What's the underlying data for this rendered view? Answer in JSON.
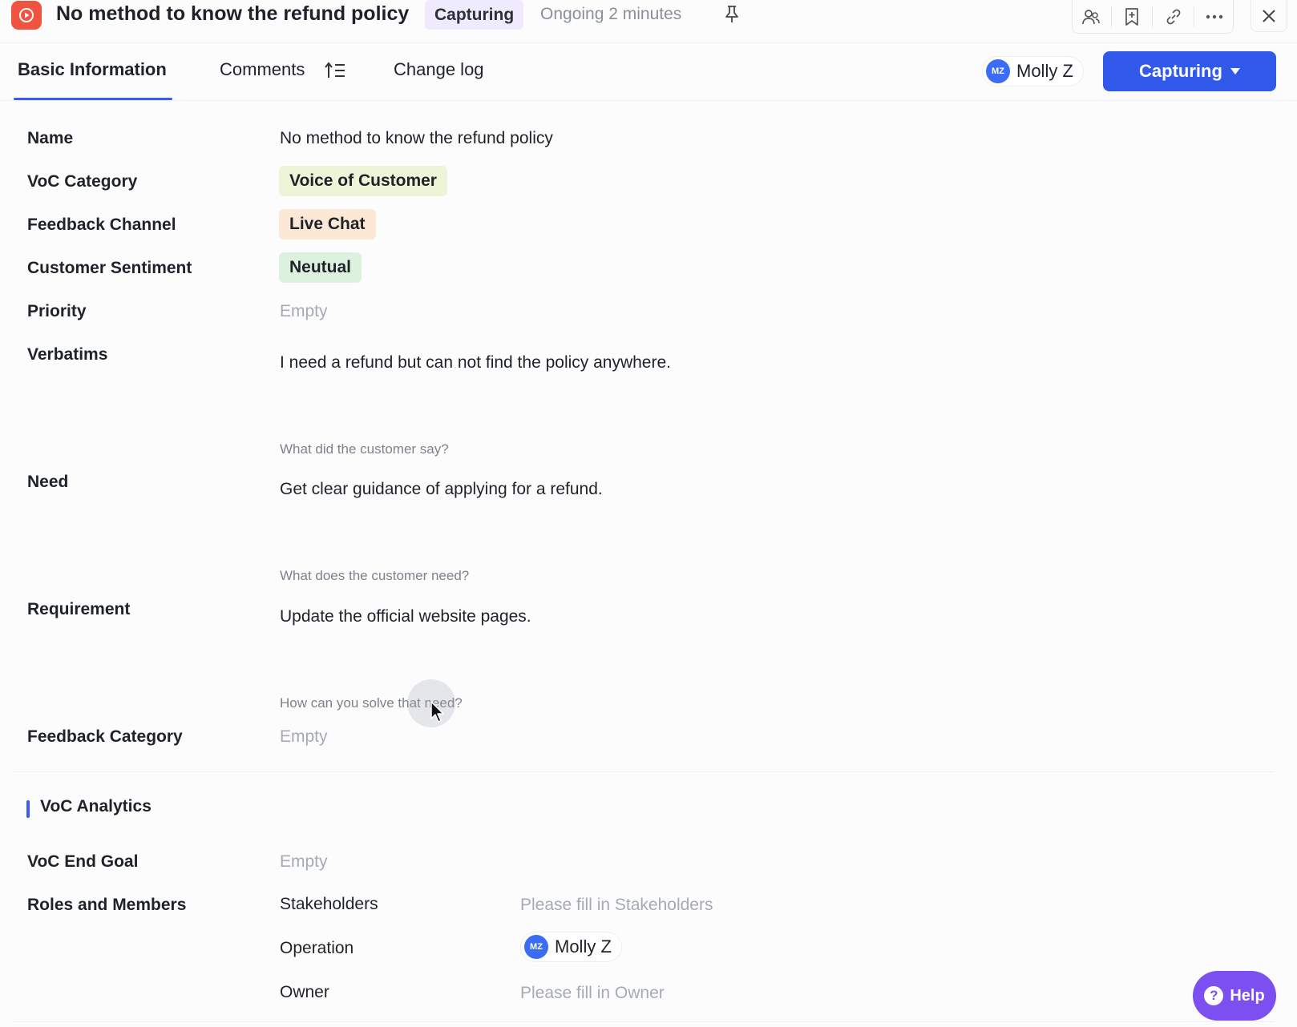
{
  "header": {
    "title": "No method to know the refund policy",
    "status_chip": "Capturing",
    "ongoing": "Ongoing 2 minutes",
    "icons": [
      "record-icon",
      "pin-icon",
      "members-icon",
      "bookmark-add-icon",
      "link-icon",
      "more-icon",
      "close-icon"
    ]
  },
  "tabs": [
    {
      "label": "Basic Information",
      "active": true
    },
    {
      "label": "Comments",
      "active": false
    },
    {
      "label": "Change log",
      "active": false
    }
  ],
  "assignee": {
    "initials": "MZ",
    "name": "Molly Z"
  },
  "primary_action": {
    "label": "Capturing"
  },
  "fields": {
    "name": {
      "label": "Name",
      "value": "No method to know the refund policy"
    },
    "voc_category": {
      "label": "VoC Category",
      "value": "Voice of Customer",
      "color": "#eef4d8"
    },
    "feedback_channel": {
      "label": "Feedback Channel",
      "value": "Live Chat",
      "color": "#fbe8d6"
    },
    "customer_sentiment": {
      "label": "Customer Sentiment",
      "value": "Neutual",
      "color": "#dcf1de"
    },
    "priority": {
      "label": "Priority",
      "value": "Empty"
    },
    "verbatims": {
      "label": "Verbatims",
      "value": "I need a refund but can not find the policy anywhere.",
      "hint": "What did the customer say?"
    },
    "need": {
      "label": "Need",
      "value": "Get clear guidance of applying for a refund.",
      "hint": "What does the customer need?"
    },
    "requirement": {
      "label": "Requirement",
      "value": "Update the official website pages.",
      "hint": "How can you solve that need?"
    },
    "feedback_category": {
      "label": "Feedback Category",
      "value": "Empty"
    }
  },
  "analytics": {
    "section_title": "VoC Analytics",
    "end_goal": {
      "label": "VoC End Goal",
      "value": "Empty"
    },
    "roles": {
      "label": "Roles and Members",
      "stakeholders": {
        "label": "Stakeholders",
        "value": "Please fill in Stakeholders"
      },
      "operation": {
        "label": "Operation",
        "initials": "MZ",
        "name": "Molly Z"
      },
      "owner": {
        "label": "Owner",
        "value": "Please fill in Owner"
      }
    }
  },
  "help": {
    "label": "Help",
    "icon": "?"
  },
  "colors": {
    "accent": "#3159ea",
    "record": "#f0533f",
    "help": "#7b4ff0"
  }
}
